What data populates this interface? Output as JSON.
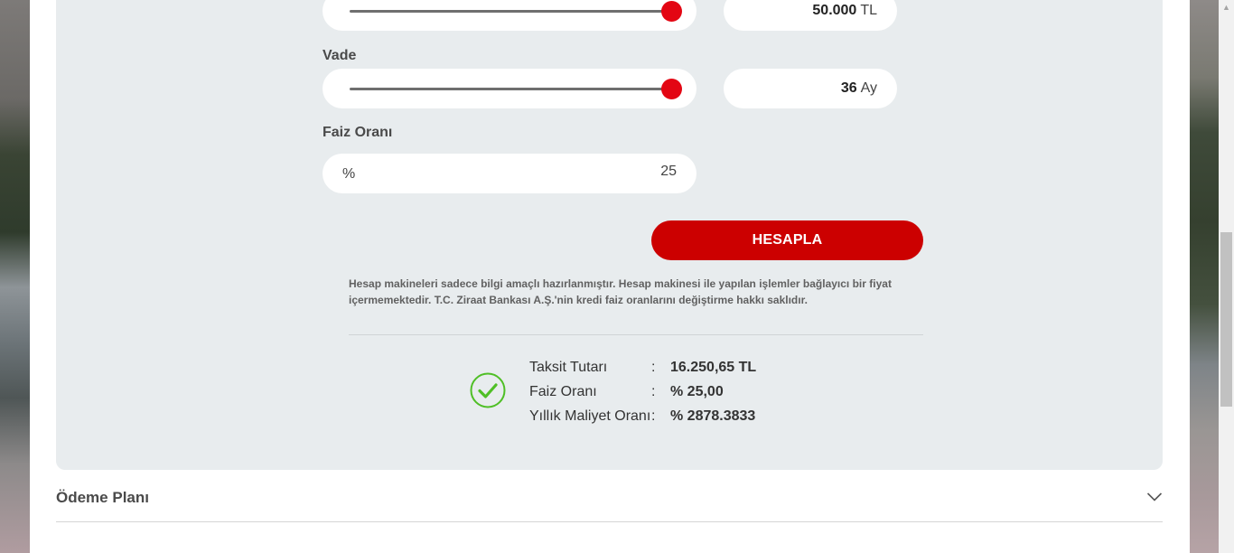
{
  "calculator": {
    "amount": {
      "value": "50.000",
      "unit": "TL",
      "slider_fraction": 1.0
    },
    "term": {
      "label": "Vade",
      "value": "36",
      "unit": "Ay",
      "slider_fraction": 1.0
    },
    "rate": {
      "label": "Faiz Oranı",
      "prefix": "%",
      "value": "25"
    },
    "calculate_label": "HESAPLA",
    "disclaimer": "Hesap makineleri sadece bilgi amaçlı hazırlanmıştır. Hesap makinesi ile yapılan işlemler bağlayıcı bir fiyat içermemektedir. T.C. Ziraat Bankası A.Ş.'nin kredi faiz oranlarını değiştirme hakkı saklıdır."
  },
  "results": {
    "icon": "check-circle-icon",
    "colon": ":",
    "rows": [
      {
        "label": "Taksit Tutarı",
        "value": "16.250,65 TL"
      },
      {
        "label": "Faiz Oranı",
        "value": "% 25,00"
      },
      {
        "label": "Yıllık Maliyet Oranı",
        "value": "% 2878.3833"
      }
    ]
  },
  "payment_plan": {
    "title": "Ödeme Planı",
    "icon": "chevron-down-icon"
  },
  "colors": {
    "accent_red": "#cc0000",
    "slider_thumb": "#e30613",
    "panel_bg": "#e8ecee",
    "check_green": "#4fbf26"
  }
}
